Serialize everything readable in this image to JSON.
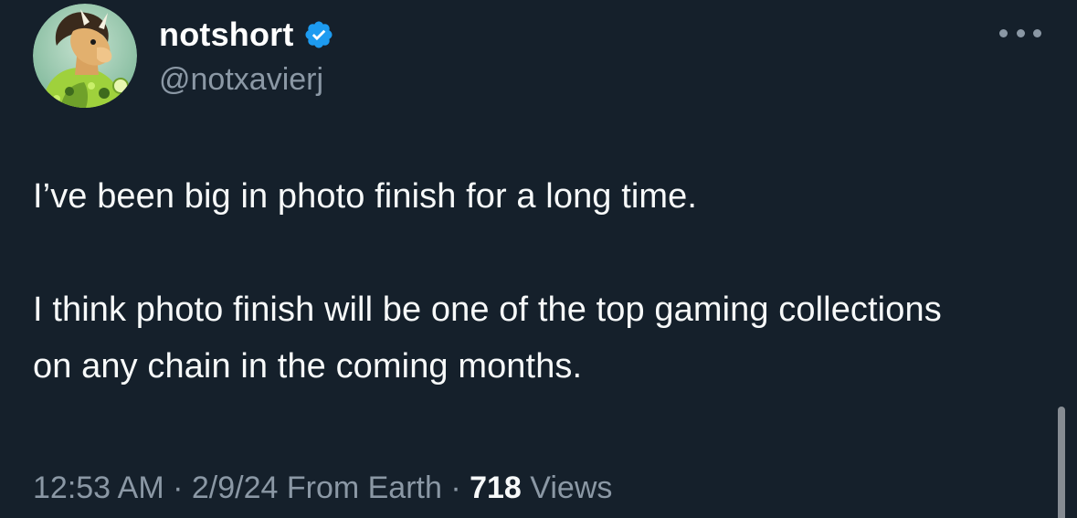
{
  "author": {
    "display_name": "notshort",
    "handle": "@notxavierj",
    "verified": true,
    "avatar_icon": "horse-avatar"
  },
  "more_icon": "more-horizontal-icon",
  "tweet": {
    "paragraph_1": "I’ve been big in photo finish for a long time.",
    "paragraph_2": "I think photo finish will be one of the top gaming collections on any chain in the coming months."
  },
  "meta": {
    "time": "12:53 AM",
    "sep1": " · ",
    "date": "2/9/24",
    "location": " From Earth",
    "sep2": " · ",
    "views_count": "718",
    "views_label": " Views"
  },
  "colors": {
    "background": "#15202b",
    "text": "#f7f9f9",
    "secondary": "#8b98a5",
    "verified": "#1d9bf0"
  }
}
